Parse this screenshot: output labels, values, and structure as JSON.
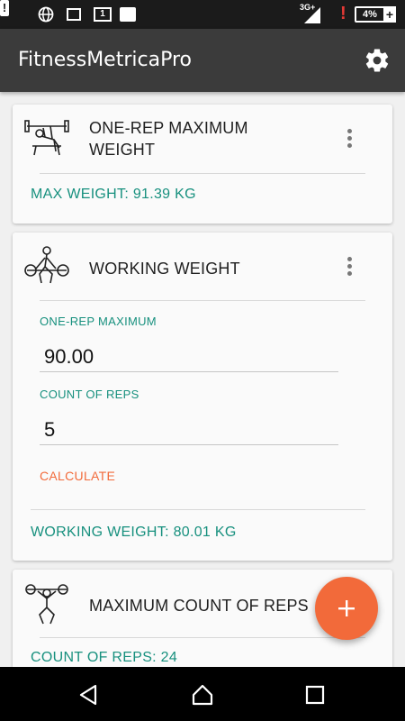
{
  "status_bar": {
    "network": "3G+",
    "battery": "4%",
    "icons": [
      "alert-icon",
      "globe-icon",
      "image-icon",
      "sim-icon",
      "play-store-icon",
      "signal-icon",
      "warning-icon",
      "battery-icon",
      "charging-icon"
    ]
  },
  "app_bar": {
    "title": "FitnessMetricaPro",
    "settings_icon": "gear-icon"
  },
  "cards": {
    "one_rep": {
      "title_line1": "ONE-REP MAXIMUM",
      "title_line2": "WEIGHT",
      "result": "MAX WEIGHT:  91.39 KG"
    },
    "working": {
      "title": "WORKING WEIGHT",
      "field1_label": "ONE-REP MAXIMUM",
      "field1_value": "90.00",
      "field2_label": "COUNT OF REPS",
      "field2_value": "5",
      "calculate_label": "CALCULATE",
      "result": "WORKING WEIGHT:  80.01 KG"
    },
    "max_reps": {
      "title": "MAXIMUM COUNT OF REPS",
      "result": "COUNT OF REPS:  24"
    }
  },
  "fab": {
    "icon": "plus-icon"
  },
  "nav_bar": {
    "icons": [
      "back-icon",
      "home-icon",
      "recents-icon"
    ]
  },
  "colors": {
    "accent_teal": "#17907e",
    "accent_orange": "#f26a3a",
    "app_bar": "#3b3b3b",
    "status_bar": "#1b1b1b"
  }
}
